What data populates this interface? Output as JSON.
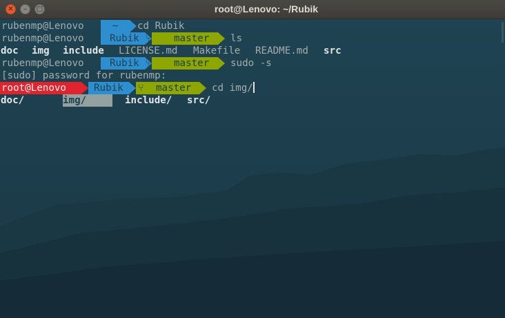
{
  "window": {
    "title": "root@Lenovo: ~/Rubik"
  },
  "prompt": {
    "user": "rubenmp@Lenovo",
    "root_user": "root@Lenovo",
    "home_dir": "~",
    "dir": "Rubik",
    "branch_icon": "git-branch-icon",
    "branch": "master"
  },
  "lines": [
    {
      "command": "cd Rubik"
    },
    {
      "command": "ls"
    },
    {
      "ls_items": [
        "doc",
        "img",
        "include",
        "LICENSE.md",
        "Makefile",
        "README.md",
        "src"
      ]
    },
    {
      "command": "sudo -s"
    },
    {
      "text": "[sudo] password for rubenmp:"
    },
    {
      "command": "cd img/"
    },
    {
      "completions": [
        "doc/",
        "img/",
        "include/",
        "src/"
      ]
    }
  ],
  "colors": {
    "root_segment": "#e0242e",
    "dir_segment": "#2e8fd0",
    "git_segment": "#8ea600",
    "terminal_bg": "#1b3a47",
    "completion_highlight": "#93a1a1"
  }
}
